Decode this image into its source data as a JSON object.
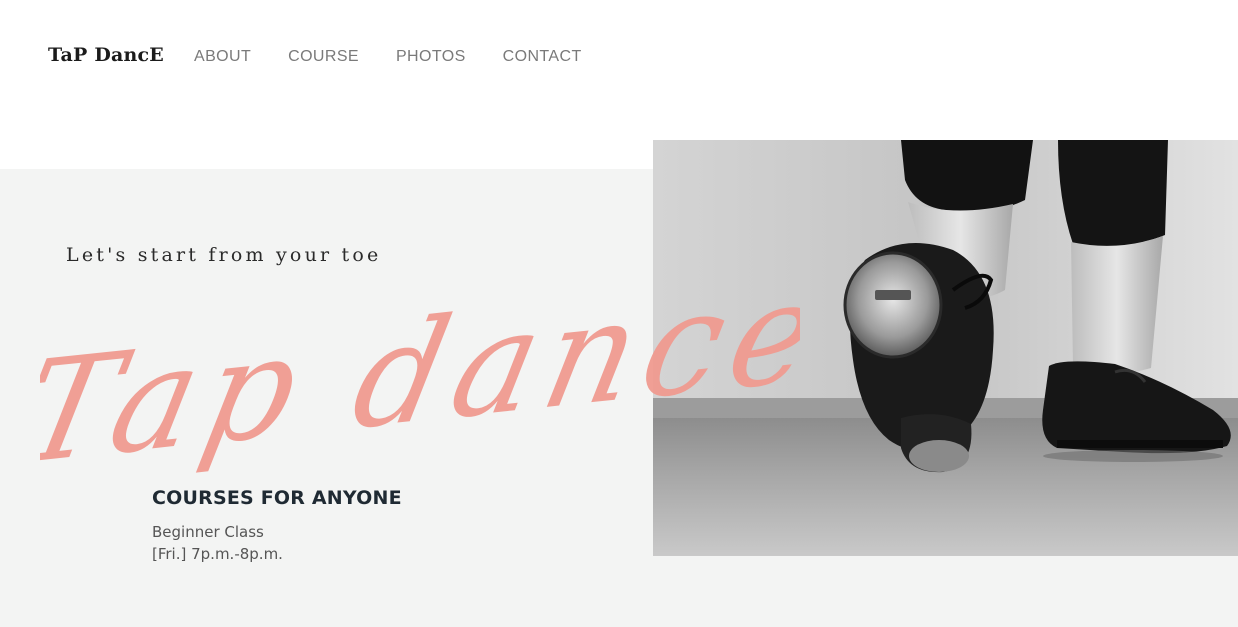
{
  "header": {
    "logo": "TaP DancE",
    "nav": [
      {
        "label": "ABOUT"
      },
      {
        "label": "COURSE"
      },
      {
        "label": "PHOTOS"
      },
      {
        "label": "CONTACT"
      }
    ]
  },
  "hero": {
    "tagline": "Let's start from your toe",
    "script_title": "Tap dance",
    "photo_alt": "tap-shoes-photo",
    "script_color": "#ef9a8f"
  },
  "courses": {
    "heading": "COURSES FOR ANYONE",
    "class_name": "Beginner Class",
    "schedule": "[Fri.] 7p.m.-8p.m."
  }
}
